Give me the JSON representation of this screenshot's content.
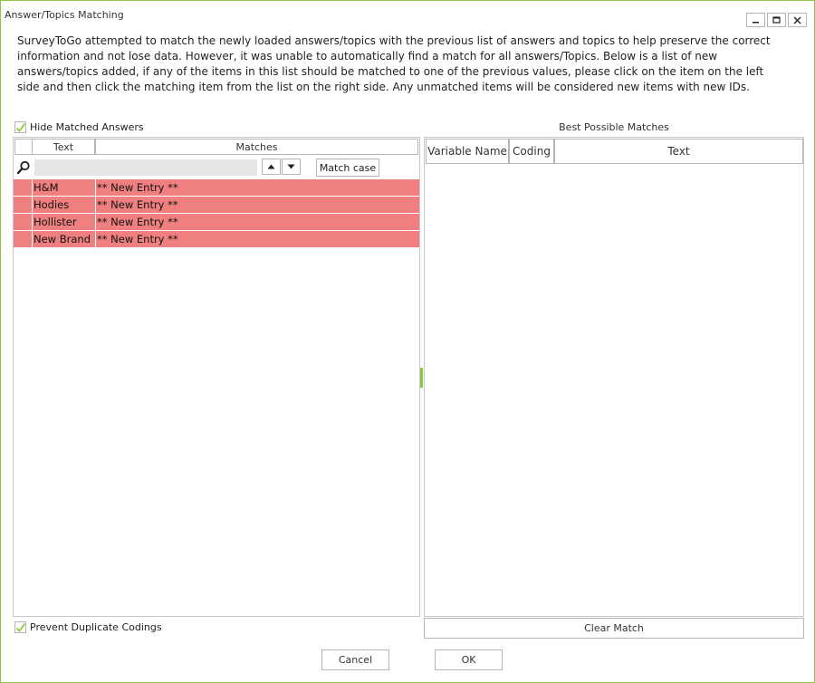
{
  "window": {
    "title": "Answer/Topics Matching",
    "minimize_label": "–",
    "maximize_label": "□",
    "close_label": "✕"
  },
  "description": "SurveyToGo attempted to match the newly loaded answers/topics with the previous list of answers and topics to help preserve the correct information and not lose data. However, it was unable to automatically find a match for all answers/Topics. Below is a list of new answers/topics added, if any of the items in this list should be matched to one of the previous values, please click on the item on the left side and then click the matching item from the list on the right side. Any unmatched items will be considered new items with new IDs.",
  "hide_matched": {
    "label": "Hide Matched Answers",
    "checked": true
  },
  "prevent_duplicates": {
    "label": "Prevent Duplicate Codings",
    "checked": true
  },
  "left_grid": {
    "columns": {
      "text": "Text",
      "matches": "Matches"
    },
    "search": {
      "value": "",
      "placeholder": ""
    },
    "match_case_label": "Match case",
    "rows": [
      {
        "text": "H&M",
        "match": "** New Entry **"
      },
      {
        "text": "Hodies",
        "match": "** New Entry **"
      },
      {
        "text": "Hollister",
        "match": "** New Entry **"
      },
      {
        "text": "New Brand",
        "match": "** New Entry **"
      }
    ],
    "row_color": "#f08080"
  },
  "right_grid": {
    "title": "Best Possible Matches",
    "columns": {
      "variable_name": "Variable Name",
      "coding": "Coding",
      "text": "Text"
    }
  },
  "buttons": {
    "clear_match": "Clear Match",
    "cancel": "Cancel",
    "ok": "OK"
  },
  "colors": {
    "accent": "#8dc63f",
    "unmatched_row": "#f08080"
  },
  "icons": {
    "search": "search-icon",
    "up": "arrow-up-icon",
    "down": "arrow-down-icon",
    "check": "check-icon"
  }
}
